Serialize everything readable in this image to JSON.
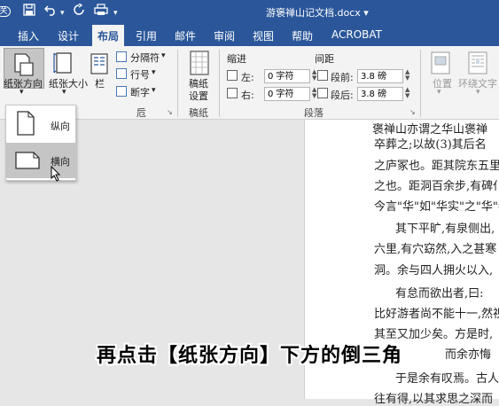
{
  "title_bar": {
    "document_title": "游褒禅山记文档.docx",
    "title_dropdown": "▾",
    "icons": [
      "autosave-icon",
      "save-icon",
      "undo-icon",
      "redo-icon",
      "print-icon"
    ]
  },
  "tabs": [
    {
      "label": "插入"
    },
    {
      "label": "设计"
    },
    {
      "label": "布局",
      "active": true
    },
    {
      "label": "引用"
    },
    {
      "label": "邮件"
    },
    {
      "label": "审阅"
    },
    {
      "label": "视图"
    },
    {
      "label": "帮助"
    },
    {
      "label": "ACROBAT"
    }
  ],
  "ribbon": {
    "page_setup": {
      "orientation_label": "纸张方向",
      "size_label": "纸张大小",
      "columns_label": "栏",
      "breaks_label": "分隔符",
      "line_numbers_label": "行号",
      "hyphenation_label": "断字",
      "group_label_partial": "卮"
    },
    "manuscript": {
      "button_label_line1": "稿纸",
      "button_label_line2": "设置",
      "group_label": "稿纸"
    },
    "paragraph": {
      "indent_header": "缩进",
      "spacing_header": "间距",
      "left_label": "左:",
      "left_value": "0 字符",
      "right_label": "右:",
      "right_value": "0 字符",
      "before_label": "段前:",
      "before_value": "3.8 磅",
      "after_label": "段后:",
      "after_value": "3.8 磅",
      "group_label": "段落"
    },
    "arrange": {
      "position_label": "位置",
      "wrap_text_label": "环绕文字"
    }
  },
  "orientation_menu": {
    "items": [
      {
        "label": "纵向"
      },
      {
        "label": "横向",
        "highlighted": true
      }
    ]
  },
  "document": {
    "lines": [
      "褒禅山亦谓之华山褒禅",
      "卒葬之;以故(3)其后名",
      "之庐冢也。距其院东五里,",
      "之也。距洞百余步,有碑仆",
      "今言\"华\"如\"华实\"之\"华\"者,",
      "其下平旷,有泉侧出,",
      "六里,有穴窈然,入之甚寒",
      "洞。余与四人拥火以入,",
      "有怠而欲出者,曰:",
      "比好游者尚不能十一,然视",
      "其至又加少矣。方是时,",
      "而余亦悔",
      "于是余有叹焉。古人之",
      "往有得,以其求思之深而"
    ]
  },
  "caption": "再点击【纸张方向】下方的倒三角"
}
